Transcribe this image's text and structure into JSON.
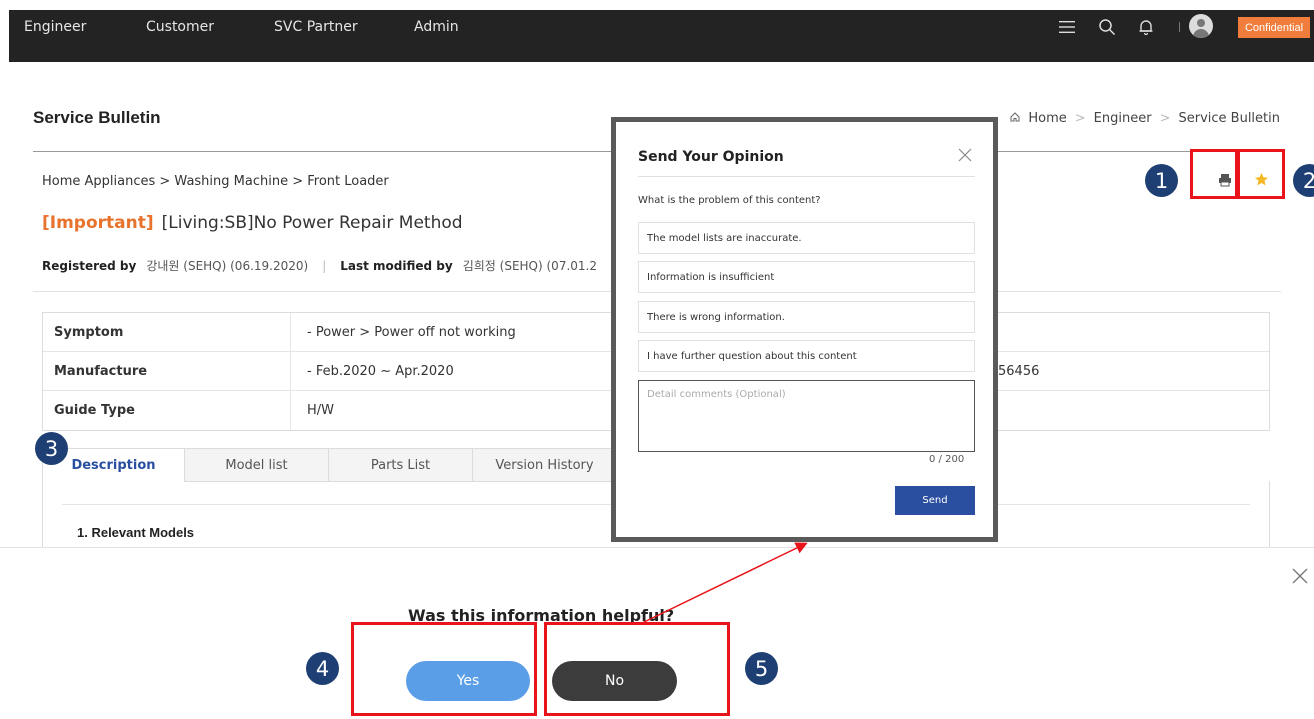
{
  "nav": {
    "links": [
      "Engineer",
      "Customer",
      "SVC Partner",
      "Admin"
    ],
    "icons": [
      "menu-icon",
      "search-icon",
      "bell-icon",
      "user-avatar-icon"
    ],
    "badge": "Confidential"
  },
  "page": {
    "title": "Service Bulletin",
    "breadcrumb": [
      "Home",
      "Engineer",
      "Service Bulletin"
    ],
    "category": "Home Appliances > Washing Machine > Front Loader",
    "tag": "[Important]",
    "headline": "[Living:SB]No Power Repair Method",
    "registered_label": "Registered by",
    "registered_value": "강내원 (SEHQ) (06.19.2020)",
    "modified_label": "Last modified by",
    "modified_value": "김희정 (SEHQ) (07.01.2"
  },
  "info": {
    "rows": [
      {
        "key": "Symptom",
        "value": "- Power > Power off not working",
        "extra": ""
      },
      {
        "key": "Manufacture",
        "value": "- Feb.2020 ~ Apr.2020",
        "extra": "56456"
      },
      {
        "key": "Guide Type",
        "value": "H/W",
        "extra": ""
      }
    ]
  },
  "tabs": {
    "items": [
      "Description",
      "Model list",
      "Parts List",
      "Version History"
    ],
    "active": "Description"
  },
  "content": {
    "section_title": "1. Relevant Models"
  },
  "modal": {
    "title": "Send Your Opinion",
    "question": "What is the problem of this content?",
    "options": [
      "The model lists are inaccurate.",
      "Information is insufficient",
      "There is wrong information.",
      "I have further question about this content"
    ],
    "comment_placeholder": "Detail comments (Optional)",
    "counter": "0 / 200",
    "send_label": "Send"
  },
  "feedback": {
    "question": "Was this information helpful?",
    "yes_label": "Yes",
    "no_label": "No"
  },
  "annotations": {
    "numbers": [
      "1",
      "2",
      "3",
      "4",
      "5"
    ],
    "highlight_color": "#e8141a",
    "marker_color": "#1d3f73"
  },
  "colors": {
    "accent": "#2a4fa0",
    "important": "#e8732d",
    "badge": "#f07d3c",
    "yes_button": "#5a9ee8",
    "no_button": "#3c3c3c"
  }
}
